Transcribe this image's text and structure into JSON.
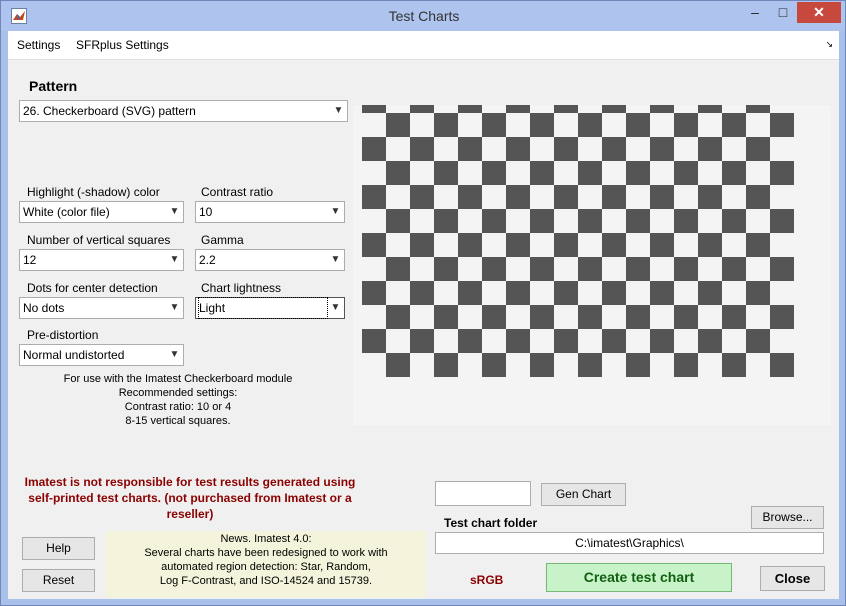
{
  "window": {
    "title": "Test Charts",
    "minimize": "–",
    "maximize": "□",
    "close": "✕"
  },
  "menu": {
    "settings": "Settings",
    "sfrplus": "SFRplus Settings",
    "corner": "↘"
  },
  "pattern": {
    "heading": "Pattern",
    "selected": "26. Checkerboard (SVG) pattern"
  },
  "fields": {
    "highlight_label": "Highlight (-shadow) color",
    "highlight_value": "White  (color file)",
    "contrast_label": "Contrast ratio",
    "contrast_value": "10",
    "vsquares_label": "Number of vertical squares",
    "vsquares_value": "12",
    "gamma_label": "Gamma",
    "gamma_value": "2.2",
    "dots_label": "Dots for center detection",
    "dots_value": "No dots",
    "lightness_label": "Chart lightness",
    "lightness_value": "Light",
    "predistortion_label": "Pre-distortion",
    "predistortion_value": "Normal undistorted"
  },
  "recommend": {
    "line1": "For use with the Imatest Checkerboard module",
    "line2": "Recommended settings:",
    "line3": "Contrast ratio: 10 or 4",
    "line4": "8-15 vertical squares."
  },
  "disclaimer": "Imatest is not responsible for test results generated using self-printed test charts. (not purchased from Imatest or a reseller)",
  "news": {
    "line1": "News.   Imatest 4.0:",
    "line2": "Several charts have been redesigned to work with",
    "line3": "automated region detection:  Star, Random,",
    "line4": "Log F-Contrast, and  ISO-14524 and 15739."
  },
  "buttons": {
    "help": "Help",
    "reset": "Reset",
    "gen_chart": "Gen Chart",
    "browse": "Browse...",
    "create": "Create test chart",
    "close": "Close"
  },
  "gen_chart_input": "",
  "folder": {
    "label": "Test chart folder",
    "path": "C:\\imatest\\Graphics\\"
  },
  "srgb": "sRGB",
  "colors": {
    "dark_square": "#555555",
    "light_square": "#f4f4f4",
    "disclaimer": "#8b0000",
    "create_button_bg": "#c8f2c8",
    "close_button_bg": "#c7493d"
  }
}
